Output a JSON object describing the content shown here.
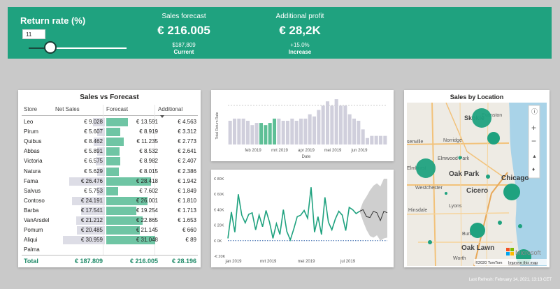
{
  "header": {
    "return_rate_title": "Return rate (%)",
    "return_rate_value": "11",
    "slider_level_pct": 22,
    "sales_forecast": {
      "label": "Sales forecast",
      "value": "€ 216.005",
      "sub1": "$187,809",
      "sub2": "Current"
    },
    "additional_profit": {
      "label": "Additional profit",
      "value": "€ 28,2K",
      "sub1": "+15.0%",
      "sub2": "Increase"
    }
  },
  "table": {
    "title": "Sales vs Forecast",
    "columns": [
      "Store",
      "Net Sales",
      "Forecast",
      "Additional"
    ],
    "rows": [
      {
        "store": "Leo",
        "net": "€ 9.028",
        "net_v": 9028,
        "fc": "€ 13.591",
        "fc_v": 13591,
        "add": "€ 4.563"
      },
      {
        "store": "Pirum",
        "net": "€ 5.607",
        "net_v": 5607,
        "fc": "€ 8.919",
        "fc_v": 8919,
        "add": "€ 3.312"
      },
      {
        "store": "Quibus",
        "net": "€ 8.462",
        "net_v": 8462,
        "fc": "€ 11.235",
        "fc_v": 11235,
        "add": "€ 2.773"
      },
      {
        "store": "Abbas",
        "net": "€ 5.891",
        "net_v": 5891,
        "fc": "€ 8.532",
        "fc_v": 8532,
        "add": "€ 2.641"
      },
      {
        "store": "Victoria",
        "net": "€ 6.575",
        "net_v": 6575,
        "fc": "€ 8.982",
        "fc_v": 8982,
        "add": "€ 2.407"
      },
      {
        "store": "Natura",
        "net": "€ 5.629",
        "net_v": 5629,
        "fc": "€ 8.015",
        "fc_v": 8015,
        "add": "€ 2.386"
      },
      {
        "store": "Fama",
        "net": "€ 26.476",
        "net_v": 26476,
        "fc": "€ 28.418",
        "fc_v": 28418,
        "add": "€ 1.942"
      },
      {
        "store": "Salvus",
        "net": "€ 5.753",
        "net_v": 5753,
        "fc": "€ 7.602",
        "fc_v": 7602,
        "add": "€ 1.849"
      },
      {
        "store": "Contoso",
        "net": "€ 24.191",
        "net_v": 24191,
        "fc": "€ 26.001",
        "fc_v": 26001,
        "add": "€ 1.810"
      },
      {
        "store": "Barba",
        "net": "€ 17.541",
        "net_v": 17541,
        "fc": "€ 19.254",
        "fc_v": 19254,
        "add": "€ 1.713"
      },
      {
        "store": "VanArsdel",
        "net": "€ 21.212",
        "net_v": 21212,
        "fc": "€ 22.865",
        "fc_v": 22865,
        "add": "€ 1.653"
      },
      {
        "store": "Pomum",
        "net": "€ 20.485",
        "net_v": 20485,
        "fc": "€ 21.145",
        "fc_v": 21145,
        "add": "€ 660"
      },
      {
        "store": "Aliqui",
        "net": "€ 30.959",
        "net_v": 30959,
        "fc": "€ 31.048",
        "fc_v": 31048,
        "add": "€ 89"
      },
      {
        "store": "Palma",
        "net": "",
        "net_v": 0,
        "fc": "",
        "fc_v": 0,
        "add": ""
      }
    ],
    "total": {
      "label": "Total",
      "net": "€ 187.809",
      "fc": "€ 216.005",
      "add": "€ 28.196"
    }
  },
  "bar_chart": {
    "ylabel": "Total Return Rate",
    "xlabel": "Date",
    "ticks": [
      "feb 2019",
      "mrt 2019",
      "apr 2019",
      "mei 2019",
      "jun 2019"
    ]
  },
  "line_chart": {
    "yticks": [
      "€ 80K",
      "€ 60K",
      "€ 40K",
      "€ 20K",
      "€ 0K",
      "-€ 20K"
    ],
    "xticks": [
      "jan 2019",
      "mrt 2019",
      "mei 2019",
      "jul 2019"
    ]
  },
  "map": {
    "title": "Sales by Location",
    "labels": [
      "Skokie",
      "Evanston",
      "Norridge",
      "Elmwood Park",
      "Oak Park",
      "Chicago",
      "Westchester",
      "Cicero",
      "Hinsdale",
      "Lyons",
      "Burbank",
      "Oak Lawn",
      "Worth",
      "Elmhurst",
      "senville"
    ],
    "attribution": "©2020 TomTom",
    "improve_link": "Improve this map",
    "ms_logo_text": "Microsoft"
  },
  "footer": {
    "refresh": "Last Refresh: February 14, 2021, 13:13 CET"
  },
  "chart_data": [
    {
      "type": "bar",
      "ylabel": "Total Return Rate",
      "xlabel": "Date",
      "values": [
        11,
        12,
        12,
        12,
        11,
        9,
        10,
        10,
        9,
        10,
        12,
        12,
        11,
        11,
        12,
        11,
        12,
        12,
        14,
        13,
        16,
        18,
        20,
        18,
        21,
        18,
        18,
        14,
        12,
        11,
        7,
        3,
        4,
        4,
        4,
        4
      ],
      "highlight": [
        7,
        8,
        9,
        10
      ]
    },
    {
      "type": "line",
      "yticks_values": [
        80,
        60,
        40,
        20,
        0,
        -20
      ],
      "values": [
        3,
        37,
        11,
        60,
        33,
        23,
        34,
        36,
        14,
        33,
        18,
        39,
        24,
        3,
        22,
        8,
        40,
        12,
        1,
        15,
        31,
        33,
        39,
        29,
        69,
        11,
        31,
        8,
        56,
        24,
        14,
        28,
        38,
        33,
        13,
        43,
        40,
        35,
        38
      ],
      "forecast": {
        "mean": [
          40,
          31,
          30,
          38,
          36,
          26,
          38,
          36
        ],
        "upper": [
          50,
          57,
          65,
          71,
          74,
          70,
          80,
          80
        ],
        "lower": [
          25,
          14,
          6,
          4,
          7,
          0,
          3,
          4
        ]
      },
      "ylim": [
        -20,
        80
      ],
      "baseline": 0
    }
  ]
}
